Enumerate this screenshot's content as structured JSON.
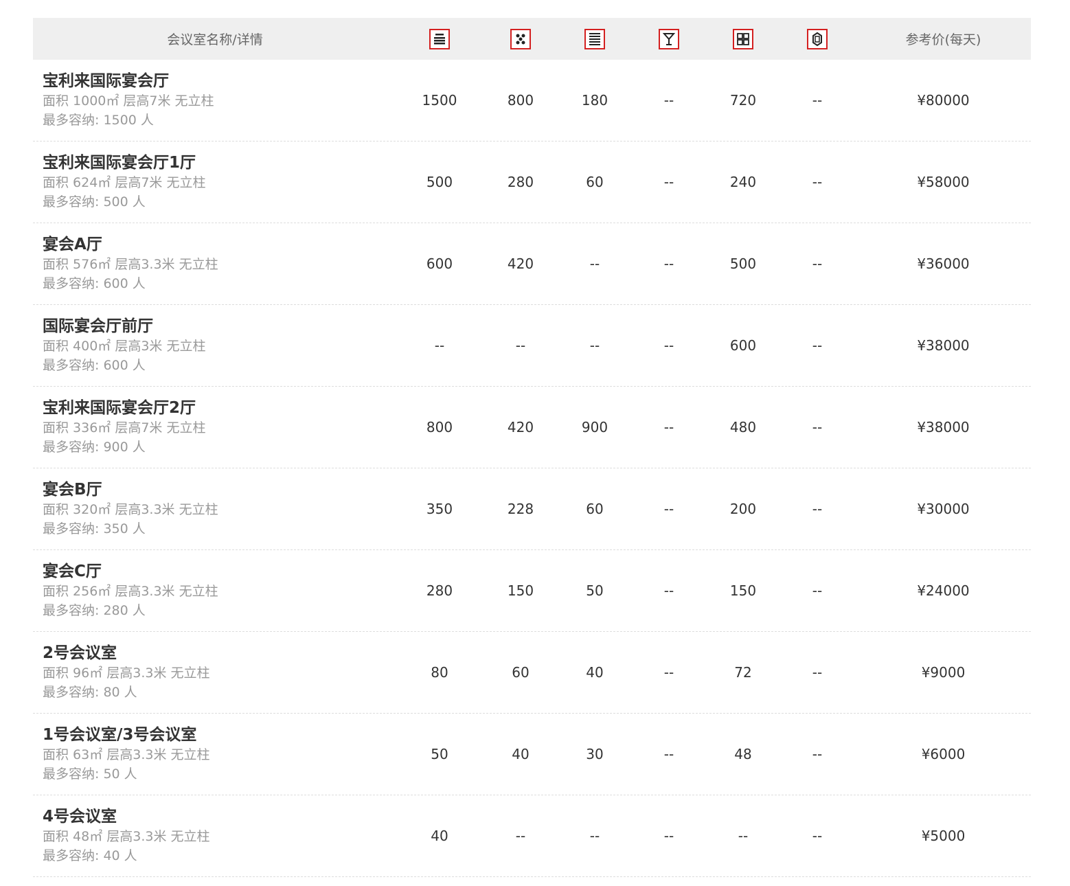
{
  "table": {
    "header": {
      "name_label": "会议室名称/详情",
      "icons": [
        "theater-layout-icon",
        "banquet-layout-icon",
        "classroom-layout-icon",
        "cocktail-layout-icon",
        "u-shape-layout-icon",
        "boardroom-layout-icon"
      ],
      "price_label": "参考价(每天)"
    },
    "rows": [
      {
        "name": "宝利来国际宴会厅",
        "area": "面积 1000㎡ 层高7米 无立柱",
        "capacity": "最多容纳: 1500 人",
        "v1": "1500",
        "v2": "800",
        "v3": "180",
        "v4": "--",
        "v5": "720",
        "v6": "--",
        "price": "¥80000"
      },
      {
        "name": "宝利来国际宴会厅1厅",
        "area": "面积 624㎡ 层高7米 无立柱",
        "capacity": "最多容纳: 500 人",
        "v1": "500",
        "v2": "280",
        "v3": "60",
        "v4": "--",
        "v5": "240",
        "v6": "--",
        "price": "¥58000"
      },
      {
        "name": "宴会A厅",
        "area": "面积 576㎡ 层高3.3米 无立柱",
        "capacity": "最多容纳: 600 人",
        "v1": "600",
        "v2": "420",
        "v3": "--",
        "v4": "--",
        "v5": "500",
        "v6": "--",
        "price": "¥36000"
      },
      {
        "name": "国际宴会厅前厅",
        "area": "面积 400㎡ 层高3米 无立柱",
        "capacity": "最多容纳: 600 人",
        "v1": "--",
        "v2": "--",
        "v3": "--",
        "v4": "--",
        "v5": "600",
        "v6": "--",
        "price": "¥38000"
      },
      {
        "name": "宝利来国际宴会厅2厅",
        "area": "面积 336㎡ 层高7米 无立柱",
        "capacity": "最多容纳: 900 人",
        "v1": "800",
        "v2": "420",
        "v3": "900",
        "v4": "--",
        "v5": "480",
        "v6": "--",
        "price": "¥38000"
      },
      {
        "name": "宴会B厅",
        "area": "面积 320㎡ 层高3.3米 无立柱",
        "capacity": "最多容纳: 350 人",
        "v1": "350",
        "v2": "228",
        "v3": "60",
        "v4": "--",
        "v5": "200",
        "v6": "--",
        "price": "¥30000"
      },
      {
        "name": "宴会C厅",
        "area": "面积 256㎡ 层高3.3米 无立柱",
        "capacity": "最多容纳: 280 人",
        "v1": "280",
        "v2": "150",
        "v3": "50",
        "v4": "--",
        "v5": "150",
        "v6": "--",
        "price": "¥24000"
      },
      {
        "name": "2号会议室",
        "area": "面积 96㎡ 层高3.3米 无立柱",
        "capacity": "最多容纳: 80 人",
        "v1": "80",
        "v2": "60",
        "v3": "40",
        "v4": "--",
        "v5": "72",
        "v6": "--",
        "price": "¥9000"
      },
      {
        "name": "1号会议室/3号会议室",
        "area": "面积 63㎡ 层高3.3米 无立柱",
        "capacity": "最多容纳: 50 人",
        "v1": "50",
        "v2": "40",
        "v3": "30",
        "v4": "--",
        "v5": "48",
        "v6": "--",
        "price": "¥6000"
      },
      {
        "name": "4号会议室",
        "area": "面积 48㎡ 层高3.3米 无立柱",
        "capacity": "最多容纳: 40 人",
        "v1": "40",
        "v2": "--",
        "v3": "--",
        "v4": "--",
        "v5": "--",
        "v6": "--",
        "price": "¥5000"
      }
    ]
  },
  "colors": {
    "header_bg": "#efefef",
    "icon_border": "#d42020",
    "detail_text": "#999999",
    "divider": "#dddddd"
  }
}
